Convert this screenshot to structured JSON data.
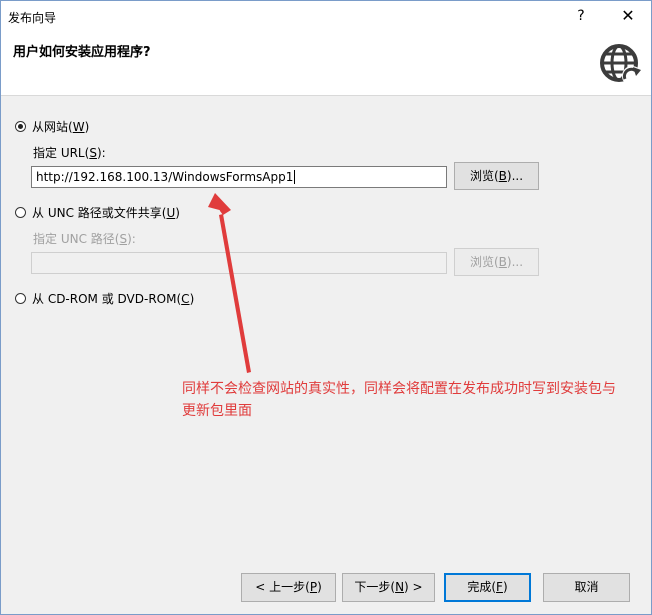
{
  "window": {
    "title": "发布向导",
    "help_glyph": "?",
    "close_glyph": "✕"
  },
  "header": {
    "title": "用户如何安装应用程序?",
    "icon": "globe-arrow-icon"
  },
  "options": {
    "website": {
      "label_pre": "从网站(",
      "label_key": "W",
      "label_post": ")",
      "checked": true,
      "url_label_pre": "指定 URL(",
      "url_label_key": "S",
      "url_label_post": "):",
      "url_value": "http://192.168.100.13/WindowsFormsApp1",
      "browse_pre": "浏览(",
      "browse_key": "B",
      "browse_post": ")..."
    },
    "unc": {
      "label_pre": "从 UNC 路径或文件共享(",
      "label_key": "U",
      "label_post": ")",
      "checked": false,
      "path_label_pre": "指定 UNC 路径(",
      "path_label_key": "S",
      "path_label_post": "):",
      "path_value": "",
      "browse_pre": "浏览(",
      "browse_key": "B",
      "browse_post": ")..."
    },
    "cdrom": {
      "label_pre": "从 CD-ROM 或 DVD-ROM(",
      "label_key": "C",
      "label_post": ")",
      "checked": false
    }
  },
  "annotation": {
    "text": "同样不会检查网站的真实性，同样会将配置在发布成功时写到安装包与更新包里面",
    "color": "#e03c3c"
  },
  "footer": {
    "prev_pre": "< 上一步(",
    "prev_key": "P",
    "prev_post": ")",
    "next_pre": "下一步(",
    "next_key": "N",
    "next_post": ") >",
    "finish_pre": "完成(",
    "finish_key": "F",
    "finish_post": ")",
    "cancel": "取消"
  }
}
